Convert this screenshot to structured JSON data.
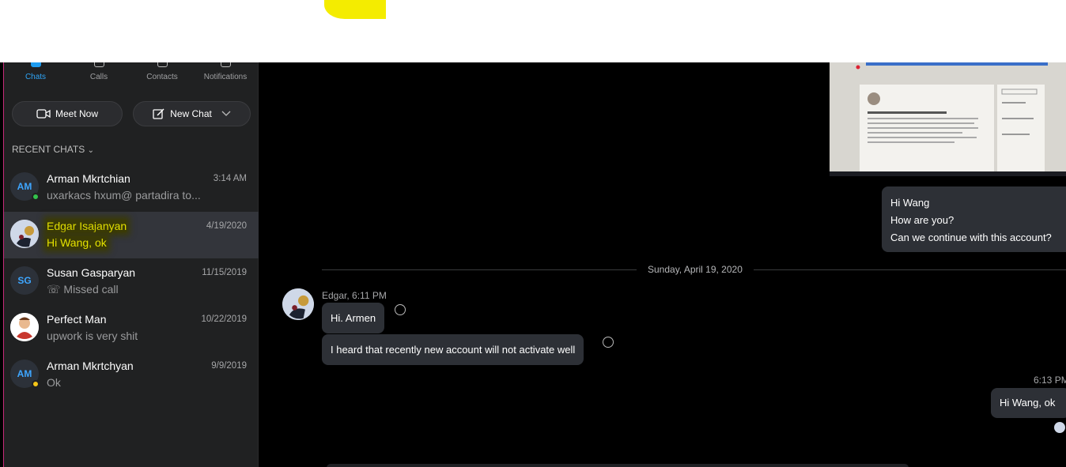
{
  "nav": [
    {
      "label": "Chats",
      "icon": "chat-icon",
      "active": true
    },
    {
      "label": "Calls",
      "icon": "phone-icon",
      "active": false
    },
    {
      "label": "Contacts",
      "icon": "contacts-icon",
      "active": false
    },
    {
      "label": "Notifications",
      "icon": "bell-icon",
      "active": false
    }
  ],
  "buttons": {
    "meet_now": "Meet Now",
    "new_chat": "New Chat"
  },
  "recent_header": "RECENT CHATS",
  "chats": [
    {
      "initials": "AM",
      "name": "Arman Mkrtchian",
      "message": "uxarkacs hxum@ partadira  to...",
      "time": "3:14 AM",
      "presence": "online"
    },
    {
      "initials": "",
      "name": "Edgar Isajanyan",
      "message": "Hi Wang, ok",
      "time": "4/19/2020",
      "selected": true
    },
    {
      "initials": "SG",
      "name": "Susan Gasparyan",
      "message": "Missed call",
      "time": "11/15/2019"
    },
    {
      "initials": "",
      "name": "Perfect Man",
      "message": "upwork is very shit",
      "time": "10/22/2019"
    },
    {
      "initials": "AM",
      "name": "Arman Mkrtchyan",
      "message": "Ok",
      "time": "9/9/2019",
      "presence": "away"
    }
  ],
  "conversation": {
    "outgoing_top": [
      "Hi Wang",
      "How are you?",
      "Can we continue with this account?"
    ],
    "date_divider": "Sunday, April 19, 2020",
    "sender_meta": "Edgar, 6:11 PM",
    "incoming": [
      "Hi. Armen",
      "I heard that recently new account will not activate well"
    ],
    "outgoing_time": "6:13 PM",
    "outgoing_last": "Hi Wang, ok"
  },
  "colors": {
    "accent": "#1e9cf0",
    "online": "#33c24d",
    "away": "#f5c518",
    "highlight": "#e4e100"
  }
}
